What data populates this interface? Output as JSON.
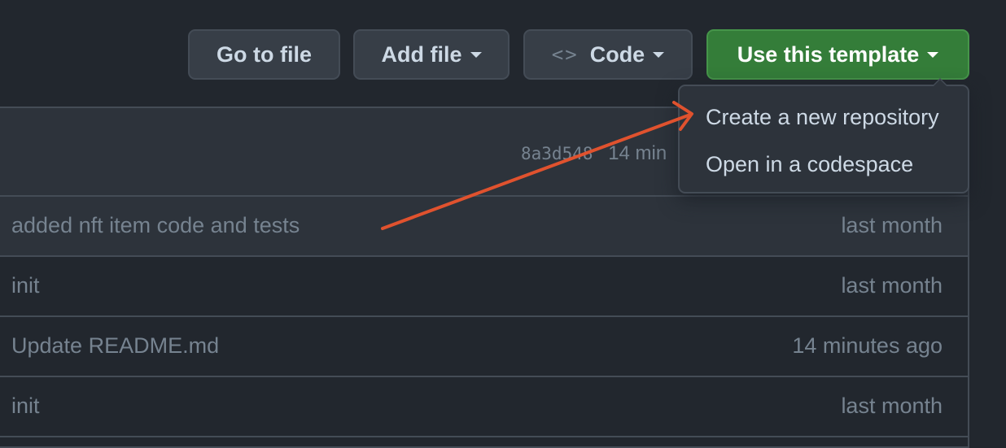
{
  "toolbar": {
    "go_to_file": "Go to file",
    "add_file": "Add file",
    "code": "Code",
    "code_icon": "code-brackets-icon",
    "use_template": "Use this template"
  },
  "commit": {
    "sha": "8a3d548",
    "age": "14 min"
  },
  "files": [
    {
      "message": "added nft item code and tests",
      "age": "last month"
    },
    {
      "message": "init",
      "age": "last month"
    },
    {
      "message": "Update README.md",
      "age": "14 minutes ago"
    },
    {
      "message": "init",
      "age": "last month"
    }
  ],
  "template_menu": {
    "items": [
      {
        "label": "Create a new repository"
      },
      {
        "label": "Open in a codespace"
      }
    ]
  },
  "annotation": {
    "type": "arrow",
    "target": "Create a new repository",
    "color": "#e0522e"
  },
  "colors": {
    "background": "#22272e",
    "primary_button": "#347d39",
    "border": "#444c56",
    "muted_text": "#768390"
  }
}
